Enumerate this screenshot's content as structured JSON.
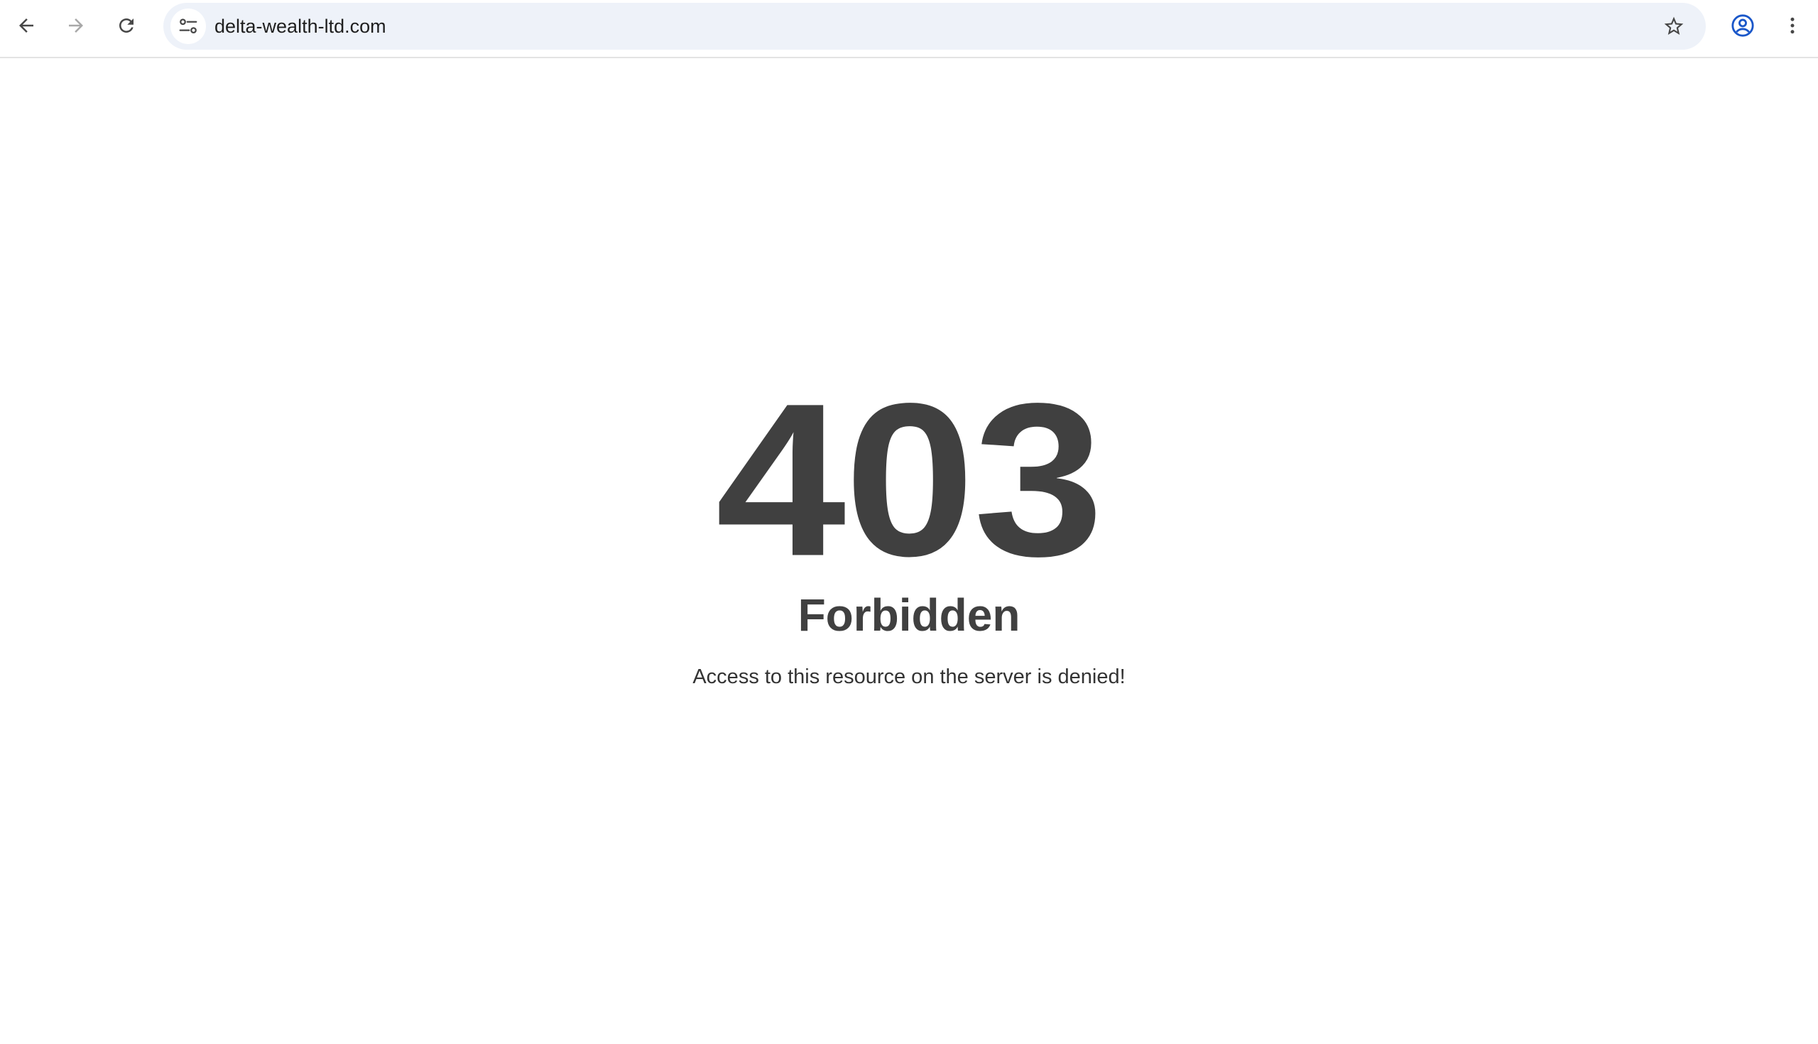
{
  "browser": {
    "url": "delta-wealth-ltd.com",
    "icons": {
      "back": "arrow-left-icon",
      "forward": "arrow-right-icon",
      "reload": "reload-icon",
      "site_info": "tune-icon",
      "bookmark": "star-icon",
      "profile": "account-circle-icon",
      "menu": "more-vertical-icon"
    },
    "colors": {
      "omnibox_bg": "#eef2f9",
      "profile_accent": "#1a57c9",
      "icon": "#474747",
      "icon_disabled": "#a8a8a8"
    }
  },
  "page": {
    "code": "403",
    "title": "Forbidden",
    "message": "Access to this resource on the server is denied!",
    "colors": {
      "text": "#404040",
      "background": "#ffffff"
    }
  }
}
